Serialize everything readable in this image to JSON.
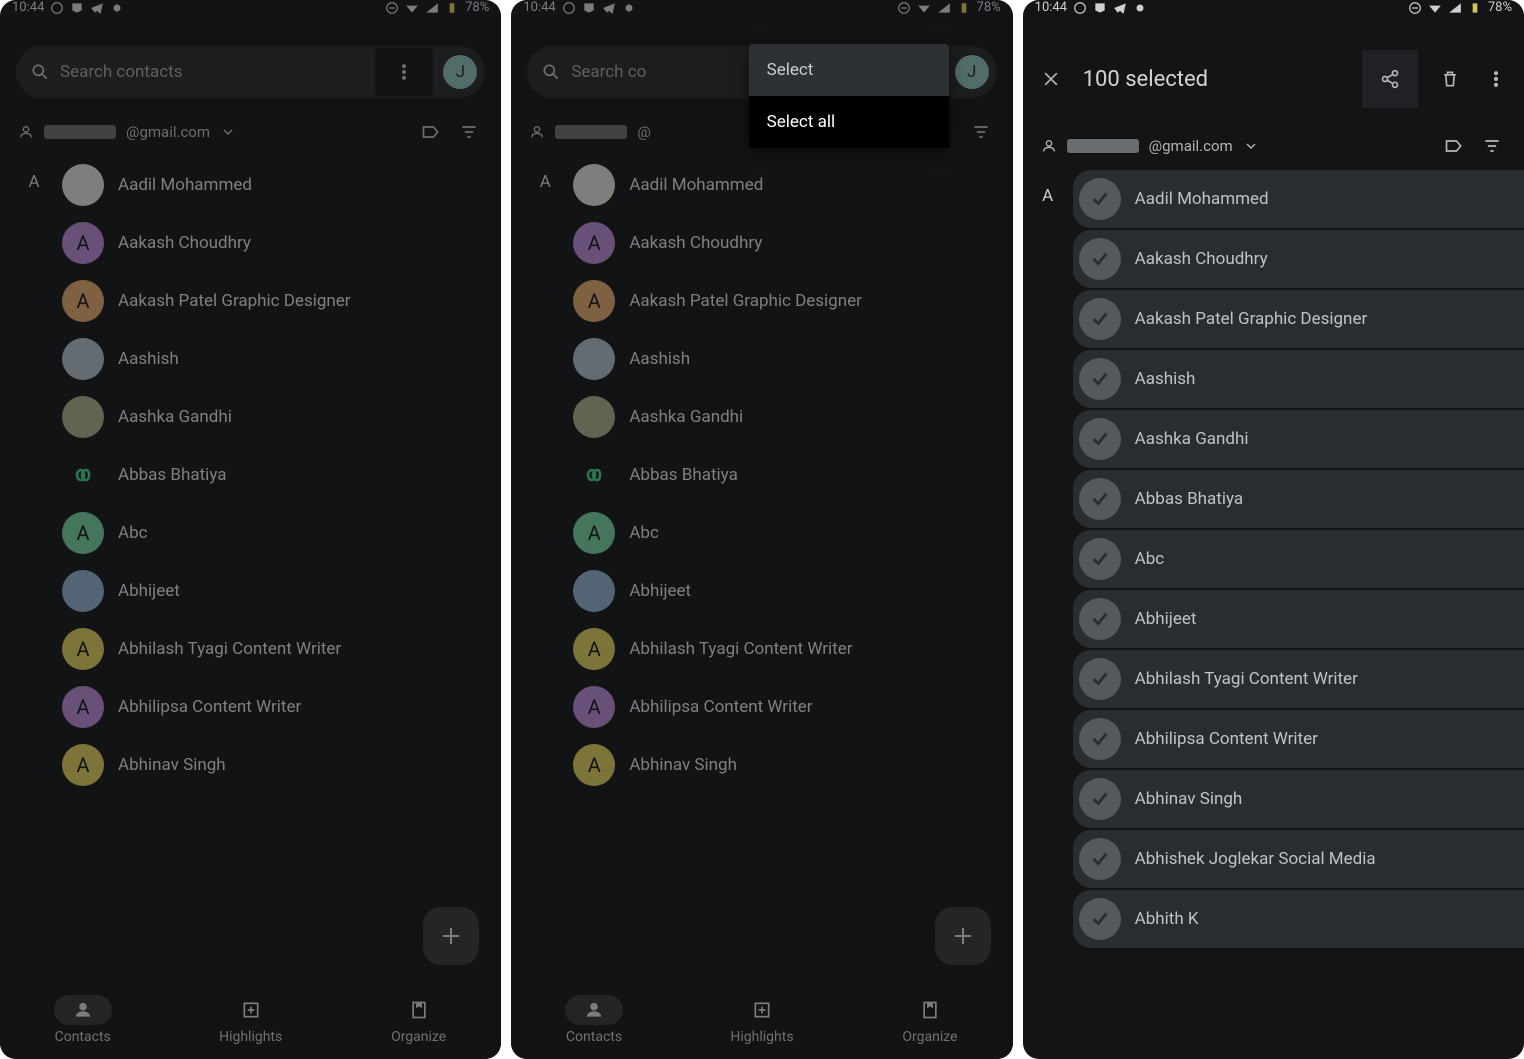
{
  "status": {
    "time": "10:44",
    "battery": "78%"
  },
  "search": {
    "placeholder": "Search contacts",
    "avatar_initial": "J"
  },
  "account": {
    "email_suffix": "@gmail.com"
  },
  "section_letter": "A",
  "contacts": [
    {
      "name": "Aadil Mohammed",
      "color": "#d2d4cf",
      "type": "photo"
    },
    {
      "name": "Aakash Choudhry",
      "color": "#b085c9",
      "initial": "A"
    },
    {
      "name": "Aakash Patel Graphic Designer",
      "color": "#d4a26e",
      "initial": "A"
    },
    {
      "name": "Aashish",
      "color": "#a7b4bc",
      "type": "photo"
    },
    {
      "name": "Aashka Gandhi",
      "color": "#a0a788",
      "type": "photo"
    },
    {
      "name": "Abbas Bhatiya",
      "color": "#1e2023",
      "type": "logo"
    },
    {
      "name": "Abc",
      "color": "#74c49a",
      "initial": "A"
    },
    {
      "name": "Abhijeet",
      "color": "#8aa7c2",
      "type": "photo"
    },
    {
      "name": "Abhilash Tyagi Content Writer",
      "color": "#cfc25f",
      "initial": "A"
    },
    {
      "name": "Abhilipsa Content Writer",
      "color": "#b085c9",
      "initial": "A"
    },
    {
      "name": "Abhinav Singh",
      "color": "#cfc25f",
      "initial": "A"
    }
  ],
  "popup": {
    "item1": "Select",
    "item2": "Select all"
  },
  "nav": {
    "contacts": "Contacts",
    "highlights": "Highlights",
    "organize": "Organize"
  },
  "selection": {
    "title": "100 selected",
    "contacts": [
      "Aadil Mohammed",
      "Aakash Choudhry",
      "Aakash Patel Graphic Designer",
      "Aashish",
      "Aashka Gandhi",
      "Abbas Bhatiya",
      "Abc",
      "Abhijeet",
      "Abhilash Tyagi Content Writer",
      "Abhilipsa Content Writer",
      "Abhinav Singh",
      "Abhishek Joglekar Social Media",
      "Abhith K"
    ]
  }
}
